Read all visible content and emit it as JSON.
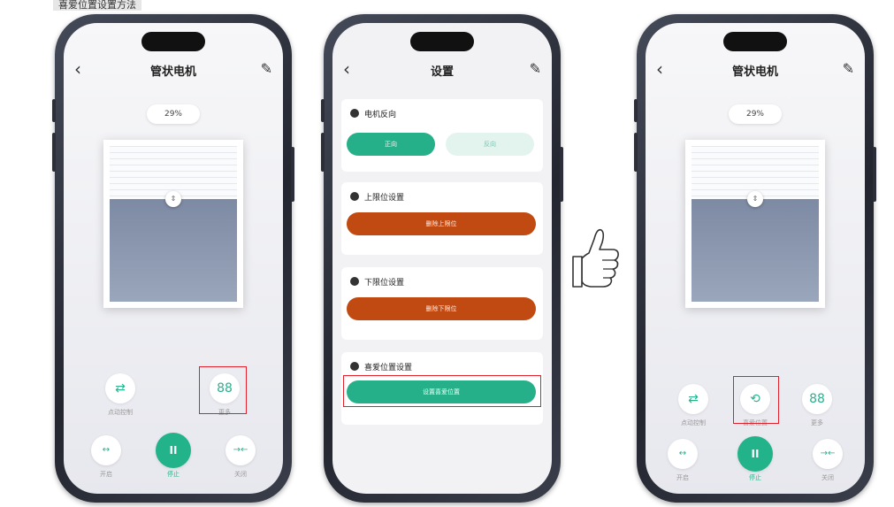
{
  "caption": "喜爱位置设置方法",
  "phone1": {
    "title": "管状电机",
    "back": "‹",
    "edit": "✎",
    "percent": "29%",
    "functions": [
      {
        "label": "点动控制",
        "icon": "sliders-icon",
        "glyph": "⇄"
      },
      {
        "label": "更多",
        "icon": "grid-icon",
        "glyph": "88"
      }
    ],
    "controls": [
      {
        "label": "开启",
        "icon": "open-icon",
        "glyph": "↔"
      },
      {
        "label": "停止",
        "icon": "pause-icon",
        "glyph": "II"
      },
      {
        "label": "关闭",
        "icon": "close-icon",
        "glyph": "→←"
      }
    ]
  },
  "phone2": {
    "title": "设置",
    "back": "‹",
    "edit": "✎",
    "sections": [
      {
        "title": "电机反向",
        "buttons": [
          "正向",
          "反向"
        ]
      },
      {
        "title": "上限位设置",
        "button": "删除上限位"
      },
      {
        "title": "下限位设置",
        "button": "删除下限位"
      },
      {
        "title": "喜爱位置设置",
        "button": "设置喜爱位置"
      }
    ]
  },
  "phone3": {
    "title": "管状电机",
    "back": "‹",
    "edit": "✎",
    "percent": "29%",
    "functions": [
      {
        "label": "点动控制",
        "icon": "sliders-icon",
        "glyph": "⇄"
      },
      {
        "label": "喜爱位置",
        "icon": "favorite-position-icon",
        "glyph": "⟲"
      },
      {
        "label": "更多",
        "icon": "grid-icon",
        "glyph": "88"
      }
    ],
    "controls": [
      {
        "label": "开启",
        "icon": "open-icon",
        "glyph": "↔"
      },
      {
        "label": "停止",
        "icon": "pause-icon",
        "glyph": "II"
      },
      {
        "label": "关闭",
        "icon": "close-icon",
        "glyph": "→←"
      }
    ]
  },
  "colors": {
    "accent_green": "#22b38a",
    "delete_brown": "#c14a12",
    "highlight_red": "#e0202a"
  }
}
